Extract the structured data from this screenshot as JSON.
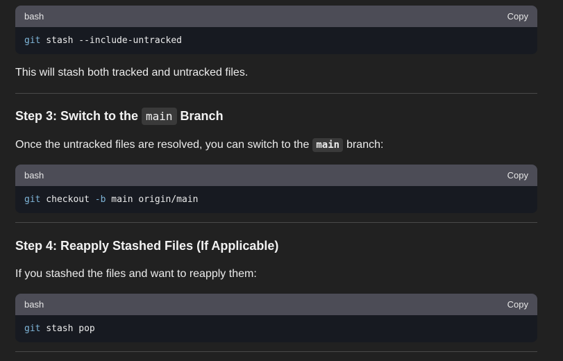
{
  "blocks": [
    {
      "lang": "bash",
      "copy_label": "Copy",
      "tokens": [
        {
          "text": "git",
          "cls": "kw"
        },
        {
          "text": " stash --include-untracked",
          "cls": ""
        }
      ]
    },
    {
      "lang": "bash",
      "copy_label": "Copy",
      "tokens": [
        {
          "text": "git",
          "cls": "kw"
        },
        {
          "text": " checkout ",
          "cls": ""
        },
        {
          "text": "-b",
          "cls": "flag"
        },
        {
          "text": " main origin/main",
          "cls": ""
        }
      ]
    },
    {
      "lang": "bash",
      "copy_label": "Copy",
      "tokens": [
        {
          "text": "git",
          "cls": "kw"
        },
        {
          "text": " stash pop",
          "cls": ""
        }
      ]
    }
  ],
  "text": {
    "p1": "This will stash both tracked and untracked files.",
    "step3_pre": "Step 3: Switch to the",
    "step3_code": "main",
    "step3_post": "Branch",
    "p2_pre": "Once the untracked files are resolved, you can switch to the",
    "p2_code": "main",
    "p2_post": "branch:",
    "step4": "Step 4: Reapply Stashed Files (If Applicable)",
    "p3": "If you stashed the files and want to reapply them:"
  }
}
